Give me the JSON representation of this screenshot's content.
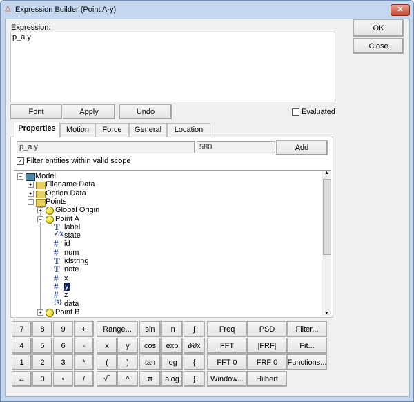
{
  "window": {
    "title": "Expression Builder (Point A-y)",
    "close_glyph": "✕"
  },
  "expression": {
    "label": "Expression:",
    "value": "p_a.y"
  },
  "buttons": {
    "ok": "OK",
    "close": "Close",
    "font": "Font",
    "apply": "Apply",
    "undo": "Undo",
    "add": "Add"
  },
  "evaluated": {
    "label": "Evaluated",
    "checked": false
  },
  "tabs": [
    "Properties",
    "Motion",
    "Force",
    "General",
    "Location"
  ],
  "active_tab": "Properties",
  "entity_field": "p_a.y",
  "value_field": "580",
  "filter": {
    "label": "Filter entities within valid scope",
    "checked": true
  },
  "tree": [
    {
      "label": "Model",
      "icon": "model-icon",
      "expander": "minus"
    },
    {
      "label": "Filename Data",
      "icon": "folder-icon",
      "expander": "plus"
    },
    {
      "label": "Option Data",
      "icon": "folder-icon",
      "expander": "plus"
    },
    {
      "label": "Points",
      "icon": "folder-open-icon",
      "expander": "minus"
    },
    {
      "label": "Global Origin",
      "icon": "point-icon",
      "expander": "plus"
    },
    {
      "label": "Point A",
      "icon": "point-icon",
      "expander": "minus"
    },
    {
      "label": "label",
      "icon": "T"
    },
    {
      "label": "state",
      "icon": "✓⁄x"
    },
    {
      "label": "id",
      "icon": "#"
    },
    {
      "label": "num",
      "icon": "#"
    },
    {
      "label": "idstring",
      "icon": "T"
    },
    {
      "label": "note",
      "icon": "T"
    },
    {
      "label": "x",
      "icon": "#"
    },
    {
      "label": "y",
      "icon": "#",
      "selected": true
    },
    {
      "label": "z",
      "icon": "#"
    },
    {
      "label": "data",
      "icon": "{#}"
    },
    {
      "label": "Point B",
      "icon": "point-icon",
      "expander": "plus"
    }
  ],
  "keypad": {
    "digits": [
      [
        "7",
        "8",
        "9",
        "+"
      ],
      [
        "4",
        "5",
        "6",
        "-"
      ],
      [
        "1",
        "2",
        "3",
        "*"
      ],
      [
        "←",
        "0",
        "•",
        "/"
      ]
    ],
    "range": "Range...",
    "x": "x",
    "y": "y",
    "lparen": "(",
    "rparen": ")",
    "sqrt": "√‾",
    "pow": "^",
    "funcs1": [
      "sin",
      "cos",
      "tan",
      "π"
    ],
    "funcs2": [
      "ln",
      "exp",
      "log",
      "alog"
    ],
    "funcs3": [
      "∫",
      "∂⁄∂x",
      "{",
      "}"
    ],
    "col4": [
      "Freq",
      "|FFT|",
      "FFT 0",
      "Window..."
    ],
    "col5": [
      "PSD",
      "|FRF|",
      "FRF 0",
      "Hilbert"
    ],
    "col6": [
      "Filter...",
      "Fit...",
      "Functions..."
    ]
  }
}
